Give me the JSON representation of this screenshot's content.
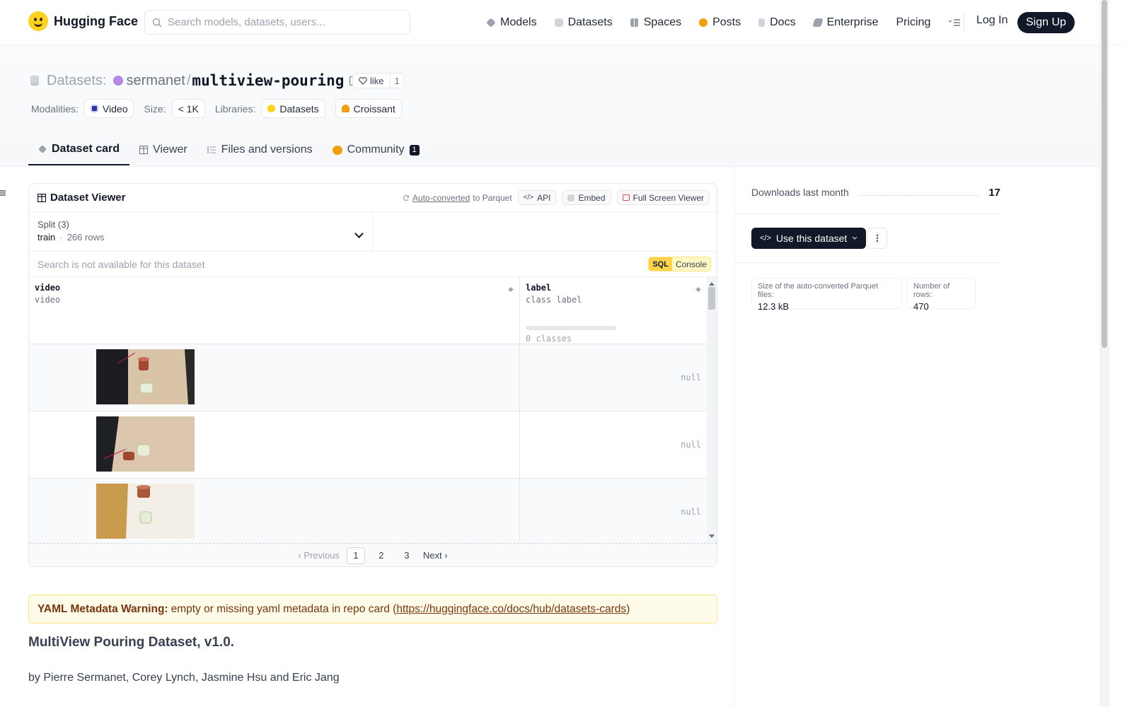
{
  "brand": {
    "name": "Hugging Face"
  },
  "search": {
    "placeholder": "Search models, datasets, users..."
  },
  "nav": {
    "items": [
      {
        "label": "Models",
        "icon": "models-icon",
        "color": "#6b7280"
      },
      {
        "label": "Datasets",
        "icon": "datasets-icon",
        "color": "#9ca3af"
      },
      {
        "label": "Spaces",
        "icon": "spaces-icon",
        "color": "#9ca3af"
      },
      {
        "label": "Posts",
        "icon": "posts-icon",
        "color": "#f59e0b"
      },
      {
        "label": "Docs",
        "icon": "docs-icon",
        "color": "#9ca3af"
      },
      {
        "label": "Enterprise",
        "icon": "enterprise-icon",
        "color": "#6b7280"
      },
      {
        "label": "Pricing"
      }
    ],
    "login": "Log In",
    "signup": "Sign Up"
  },
  "header": {
    "section": "Datasets:",
    "owner": "sermanet",
    "separator": "/",
    "repo": "multiview-pouring",
    "like_label": "like",
    "like_count": "1",
    "tags": {
      "modalities_label": "Modalities:",
      "modality": "Video",
      "size_label": "Size:",
      "size": "< 1K",
      "libraries_label": "Libraries:",
      "libraries": [
        "Datasets",
        "Croissant"
      ]
    }
  },
  "tabs": [
    {
      "label": "Dataset card",
      "active": true
    },
    {
      "label": "Viewer"
    },
    {
      "label": "Files and versions"
    },
    {
      "label": "Community",
      "badge": "1"
    }
  ],
  "viewer": {
    "title": "Dataset Viewer",
    "auto_converted": "Auto-converted",
    "to_parquet": "to Parquet",
    "api": "API",
    "embed": "Embed",
    "full_screen": "Full Screen Viewer",
    "split_label": "Split (3)",
    "split_value": "train",
    "split_rows": "266 rows",
    "search_placeholder": "Search is not available for this dataset",
    "sql": "SQL",
    "console": "Console",
    "columns": [
      {
        "name": "video",
        "type": "video"
      },
      {
        "name": "label",
        "type": "class label",
        "classes": "0 classes"
      }
    ],
    "rows": [
      {
        "label": "null"
      },
      {
        "label": "null"
      },
      {
        "label": "null"
      }
    ],
    "pager": {
      "prev": "Previous",
      "pages": [
        "1",
        "2",
        "3"
      ],
      "current": "1",
      "next": "Next"
    }
  },
  "warning": {
    "title": "YAML Metadata Warning:",
    "text": "empty or missing yaml metadata in repo card (",
    "link": "https://huggingface.co/docs/hub/datasets-cards",
    "close": ")"
  },
  "article": {
    "heading": "MultiView Pouring Dataset, v1.0.",
    "byline": "by Pierre Sermanet, Corey Lynch, Jasmine Hsu and Eric Jang"
  },
  "sidebar": {
    "downloads_label": "Downloads last month",
    "downloads": "17",
    "use_dataset": "Use this dataset",
    "parquet_size_label": "Size of the auto-converted Parquet files:",
    "parquet_size": "12.3 kB",
    "num_rows_label": "Number of rows:",
    "num_rows": "470"
  }
}
